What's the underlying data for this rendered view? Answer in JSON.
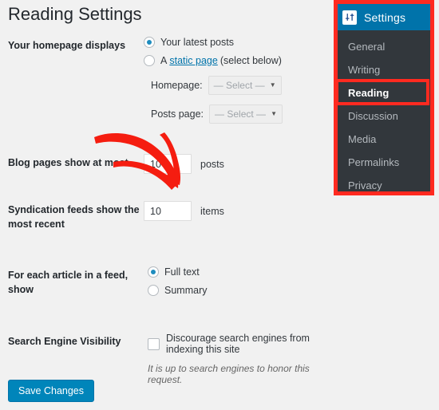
{
  "page": {
    "title": "Reading Settings",
    "background_color": "#f1f1f1"
  },
  "settings_form": {
    "homepage_displays": {
      "label": "Your homepage displays",
      "options": [
        {
          "label": "Your latest posts",
          "selected": true
        },
        {
          "lead": "A",
          "link": "static page",
          "trail": "(select below)",
          "selected": false
        }
      ],
      "selects": [
        {
          "label": "Homepage:",
          "value": "— Select —",
          "caret": "chevron-down-icon"
        },
        {
          "label": "Posts page:",
          "value": "— Select —",
          "caret": "chevron-down-icon"
        }
      ]
    },
    "blog_pages": {
      "label": "Blog pages show at most",
      "value": "10",
      "suffix": "posts"
    },
    "syndication_feeds": {
      "label": "Syndication feeds show the most recent",
      "value": "10",
      "suffix": "items"
    },
    "feed_article": {
      "label": "For each article in a feed, show",
      "options": [
        {
          "label": "Full text",
          "selected": true
        },
        {
          "label": "Summary",
          "selected": false
        }
      ]
    },
    "search_engine_visibility": {
      "label": "Search Engine Visibility",
      "checkbox_label": "Discourage search engines from indexing this site",
      "checked": false,
      "hint": "It is up to search engines to honor this request."
    },
    "save_label": "Save Changes"
  },
  "sidebar": {
    "header": {
      "title": "Settings",
      "icon": "settings-sliders-icon",
      "background_color": "#0073aa"
    },
    "items": [
      {
        "label": "General",
        "active": false
      },
      {
        "label": "Writing",
        "active": false
      },
      {
        "label": "Reading",
        "active": true
      },
      {
        "label": "Discussion",
        "active": false
      },
      {
        "label": "Media",
        "active": false
      },
      {
        "label": "Permalinks",
        "active": false
      },
      {
        "label": "Privacy",
        "active": false
      }
    ],
    "background_color": "#32373c",
    "text_color": "#b4b9be"
  },
  "annotations": {
    "highlight_color": "#ff2a20",
    "arrow_color": "#f51d10",
    "arrow_target": "Blog pages show at most input"
  }
}
